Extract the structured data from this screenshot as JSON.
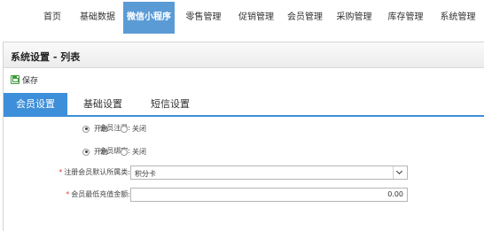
{
  "nav": {
    "items": [
      {
        "label": "首页"
      },
      {
        "label": "基础数据"
      },
      {
        "label": "微信小程序",
        "active": true
      },
      {
        "label": "零售管理"
      },
      {
        "label": "促销管理"
      },
      {
        "label": "会员管理"
      },
      {
        "label": "采购管理"
      },
      {
        "label": "库存管理"
      },
      {
        "label": "系统管理"
      }
    ]
  },
  "panel": {
    "title": "系统设置 - 列表",
    "save_label": "保存"
  },
  "tabs": [
    {
      "label": "会员设置",
      "active": true
    },
    {
      "label": "基础设置"
    },
    {
      "label": "短信设置"
    }
  ],
  "form": {
    "member_register": {
      "label": "会员注册:",
      "options": [
        "开启",
        "关闭"
      ],
      "selected": "开启"
    },
    "member_bind": {
      "label": "会员绑定:",
      "options": [
        "开启",
        "关闭"
      ],
      "selected": "开启"
    },
    "default_type": {
      "label": "注册会员默认所属类:",
      "value": "积分卡"
    },
    "min_recharge": {
      "label": "会员最低充值金额:",
      "value": "0.00"
    }
  },
  "colors": {
    "nav_active": "#5b9bd5",
    "tab_active": "#3d8fd9",
    "required_star": "#e23c3c",
    "save_icon": "#3a9d3a"
  }
}
